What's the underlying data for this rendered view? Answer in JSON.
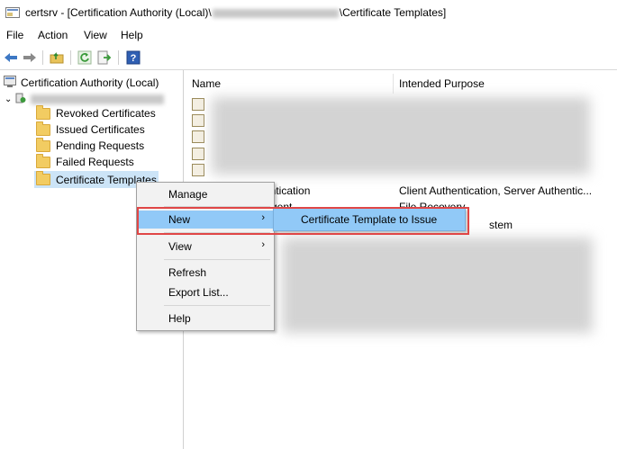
{
  "window": {
    "title_prefix": "certsrv - [Certification Authority (Local)\\",
    "title_suffix": "\\Certificate Templates]"
  },
  "menubar": {
    "items": [
      "File",
      "Action",
      "View",
      "Help"
    ]
  },
  "toolbar": {
    "icons": [
      "back-arrow-icon",
      "forward-arrow-icon",
      "up-folder-icon",
      "refresh-icon",
      "export-icon",
      "help-icon"
    ]
  },
  "tree": {
    "root": "Certification Authority (Local)",
    "children": [
      "Revoked Certificates",
      "Issued Certificates",
      "Pending Requests",
      "Failed Requests",
      "Certificate Templates"
    ]
  },
  "list": {
    "columns": [
      "Name",
      "Intended Purpose"
    ],
    "visible_cells": [
      {
        "name": "entication",
        "purpose": "Client Authentication, Server Authentic..."
      },
      {
        "name": "Agent",
        "purpose": "File Recovery"
      },
      {
        "name": "",
        "purpose": "stem"
      }
    ]
  },
  "context_menu": {
    "items": [
      "Manage",
      "New",
      "View",
      "Refresh",
      "Export List...",
      "Help"
    ]
  },
  "submenu": {
    "items": [
      "Certificate Template to Issue"
    ]
  },
  "colors": {
    "highlight": "#91c9f7",
    "annotation_box": "#e04646",
    "tree_selected": "#cce4f7"
  }
}
